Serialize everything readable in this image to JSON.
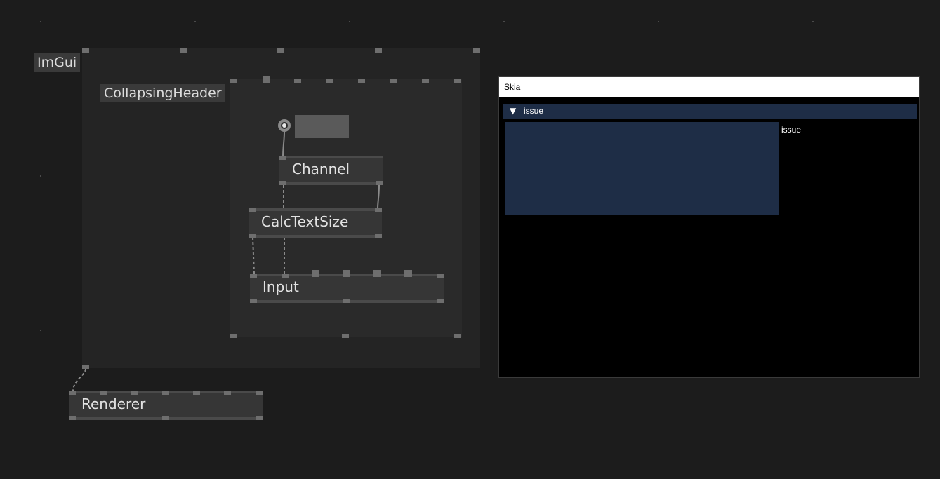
{
  "canvas": {
    "regions": {
      "imgui_label": "ImGui",
      "collapsing_header_label": "CollapsingHeader"
    },
    "nodes": {
      "channel": "Channel",
      "calc_text_size": "CalcTextSize",
      "input": "Input",
      "renderer": "Renderer"
    }
  },
  "skia_window": {
    "title": "Skia",
    "header": {
      "arrow": "▼",
      "label": "issue"
    },
    "input_label": "issue"
  },
  "colors": {
    "background": "#1c1c1c",
    "node": "#363636",
    "skia_accent": "#1e2d46"
  }
}
